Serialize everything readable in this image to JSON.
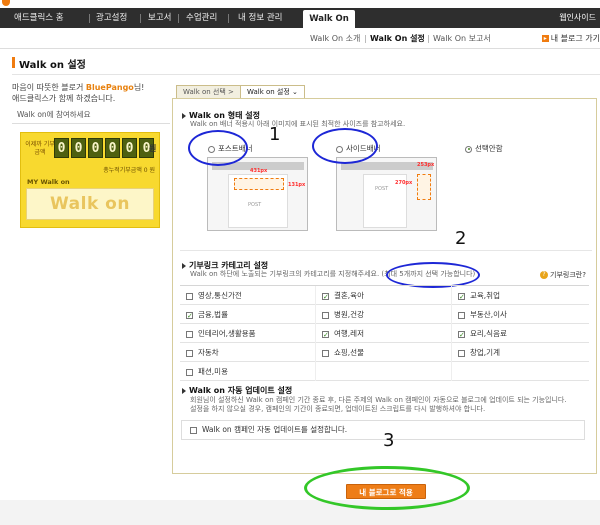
{
  "nav": {
    "items": [
      "애드클릭스 홈",
      "광고설정",
      "보고서",
      "수업관리",
      "내 정보 관리"
    ],
    "active": "Walk On",
    "right": "웹인사이드 "
  },
  "subnav": {
    "items": [
      "Walk On 소개",
      "Walk On 설정",
      "Walk On 보고서"
    ],
    "active_index": 1,
    "blog_go": "내 블로그 가기"
  },
  "page": {
    "title": "Walk on 설정"
  },
  "left": {
    "greet_prefix": "마음이 따뜻한 블로거 ",
    "user_name": "BluePango",
    "greet_suffix": "님!",
    "greet_line2": "애드클릭스가 함께 하겠습니다.",
    "join": "Walk on에 참여하세요",
    "counter_label": "이제까 기부금액",
    "digits": [
      "0",
      "0",
      "0",
      "0",
      "0",
      "0"
    ],
    "digit_unit": "원",
    "total_label": "총누적기부금액 0 원",
    "my_walkon": "MY Walk on",
    "logo_text": "Walk on",
    "brand_color": "#f8d92f"
  },
  "tabs": [
    "Walk on 선택 >",
    "Walk on 설정 ⌄"
  ],
  "section1": {
    "title": "Walk on 형태 설정",
    "desc": "Walk on 배너 적용시 아래 이미지에 표시된 최적한 사이즈를 참고하세요.",
    "options": [
      {
        "label": "포스트배너",
        "selected": false
      },
      {
        "label": "사이드배너",
        "selected": false
      },
      {
        "label": "선택안함",
        "selected": true
      }
    ],
    "preview1": {
      "post_label": "POST",
      "size_tag": "431px",
      "height_tag": "131px"
    },
    "preview2": {
      "post_label": "POST",
      "size_tag": "253px",
      "height_tag": "270px"
    }
  },
  "section2": {
    "title": "기부링크 카테고리 설정",
    "desc": "Walk on 하단에 노출되는 기부링크의 카테고리를 지정해주세요. (최대 5개까지 선택 가능합니다)",
    "help": "기부링크란?",
    "categories": [
      [
        {
          "label": "영상,통신가전",
          "checked": false
        },
        {
          "label": "결혼,육아",
          "checked": true
        },
        {
          "label": "교육,취업",
          "checked": true
        }
      ],
      [
        {
          "label": "금융,법률",
          "checked": true
        },
        {
          "label": "병원,건강",
          "checked": false
        },
        {
          "label": "부동산,이사",
          "checked": false
        }
      ],
      [
        {
          "label": "인테리어,생활용품",
          "checked": false
        },
        {
          "label": "여행,레저",
          "checked": true
        },
        {
          "label": "요리,식음료",
          "checked": true
        }
      ],
      [
        {
          "label": "자동차",
          "checked": false
        },
        {
          "label": "쇼핑,선물",
          "checked": false
        },
        {
          "label": "창업,기계",
          "checked": false
        }
      ],
      [
        {
          "label": "패션,미용",
          "checked": false
        },
        {
          "label": "",
          "checked": false
        },
        {
          "label": "",
          "checked": false
        }
      ]
    ]
  },
  "section3": {
    "title": "Walk on 자동 업데이트 설정",
    "desc1": "회원님이 설정하신 Walk on 캠페인 기간 종료 후, 다른 주제의 Walk on 캠페인이 자동으로 블로그에 업데이트 되는 기능입니다.",
    "desc2": "설정을 하지 않으실 경우, 캠페인의 기간이 종료되면, 업데이트된 스크립트를 다시 발행하셔야 합니다.",
    "checkbox_label": "Walk on 캠페인 자동 업데이트를 설정합니다."
  },
  "apply": {
    "label": "내 블로그로 적용"
  },
  "annotations": [
    "1",
    "2",
    "3"
  ],
  "colors": {
    "accent": "#ee7d17",
    "annotation_blue": "#1d27d6",
    "annotation_green": "#33c728"
  }
}
